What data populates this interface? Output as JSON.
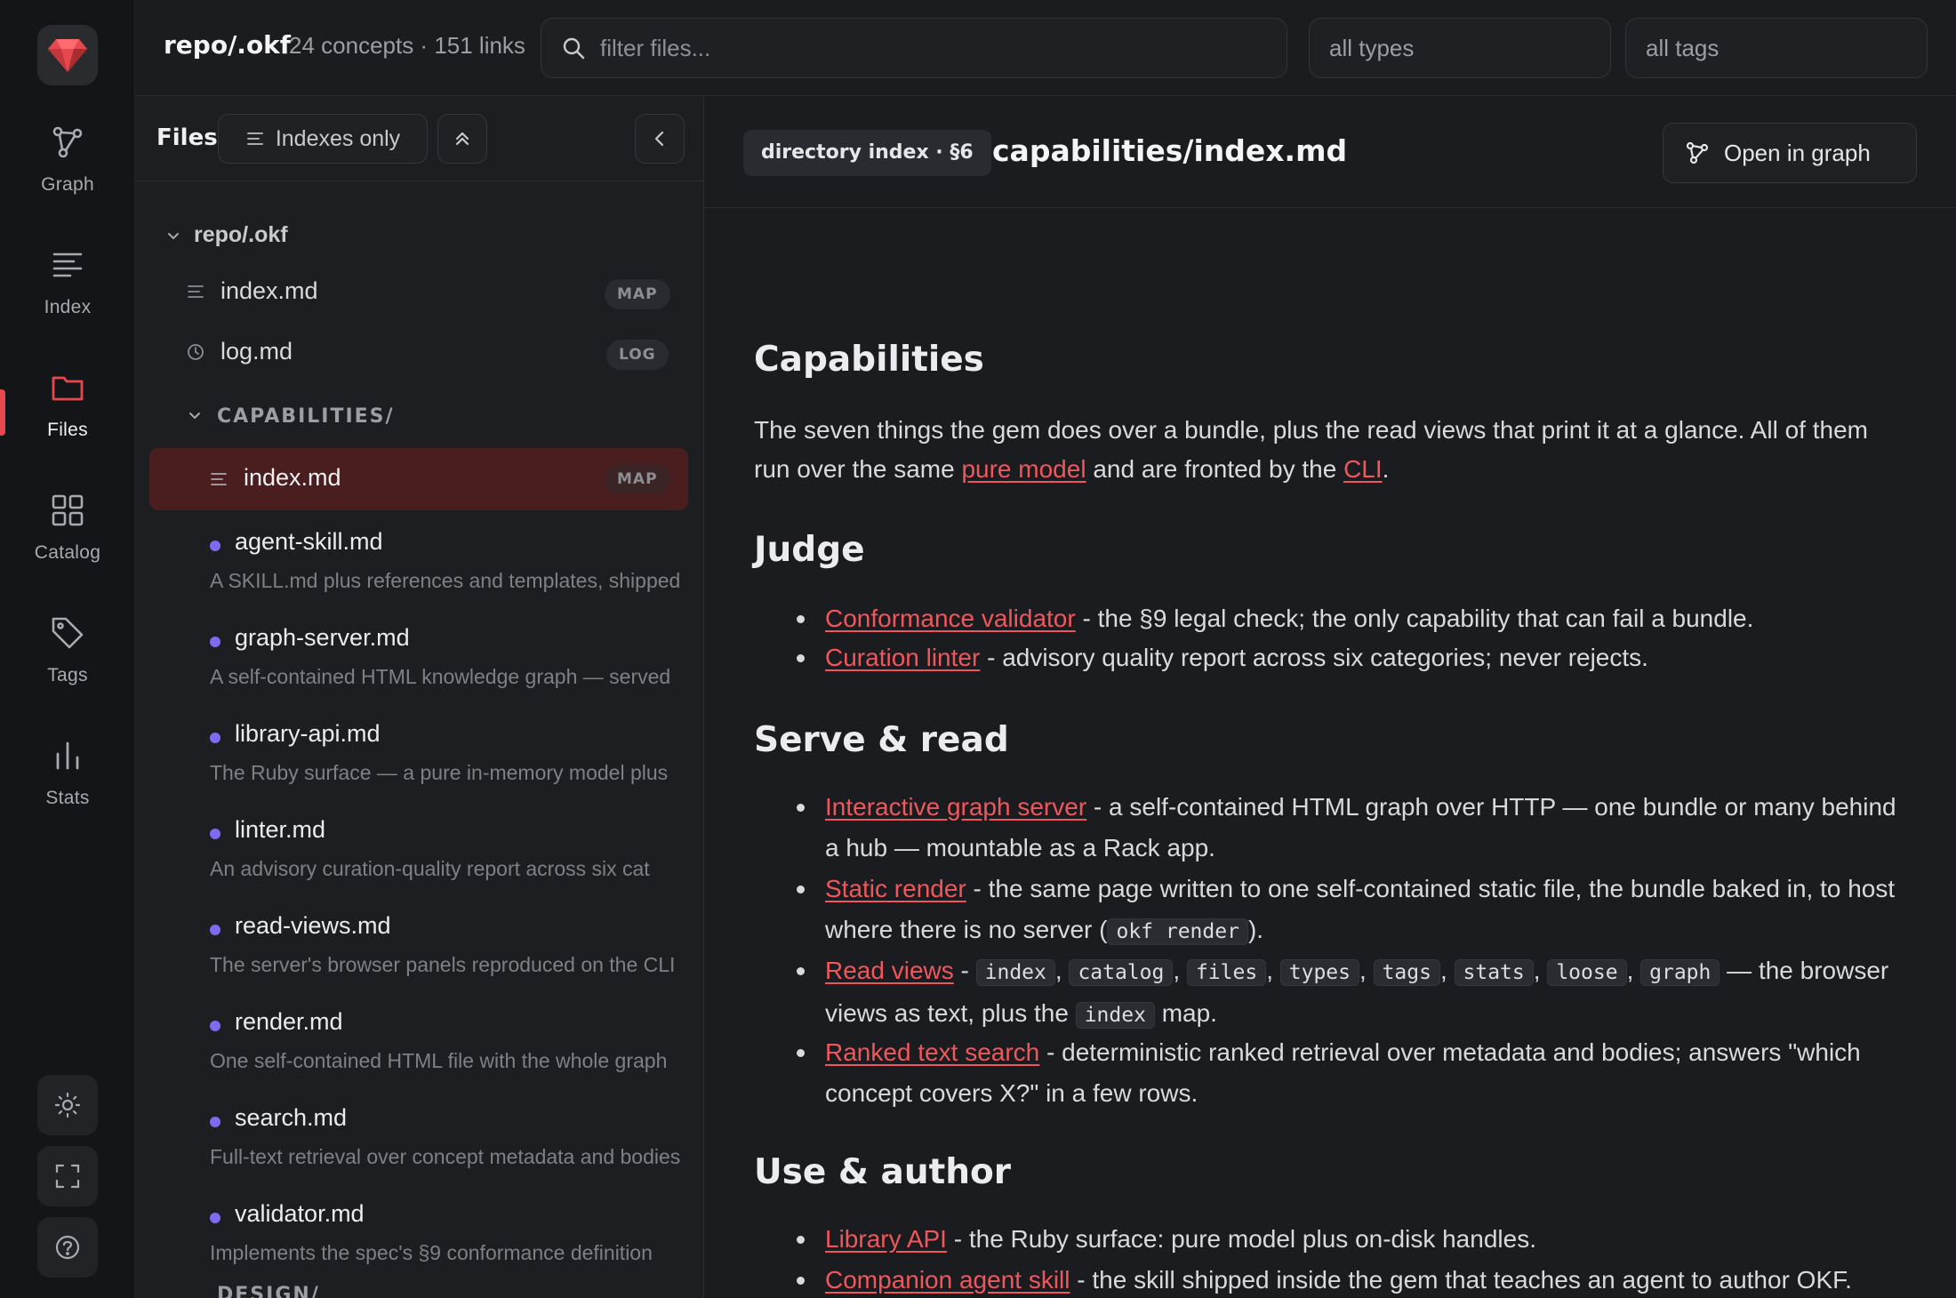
{
  "rail": {
    "items": [
      {
        "label": "Graph"
      },
      {
        "label": "Index"
      },
      {
        "label": "Files"
      },
      {
        "label": "Catalog"
      },
      {
        "label": "Tags"
      },
      {
        "label": "Stats"
      }
    ],
    "active": "Files"
  },
  "topbar": {
    "repo": "repo/.okf",
    "stats": "24 concepts · 151 links",
    "search_placeholder": "filter files...",
    "types_select": "all types",
    "tags_select": "all tags"
  },
  "files": {
    "title": "Files",
    "indexes_only": "Indexes only",
    "root_folder": "repo/.okf",
    "root_items": [
      {
        "name": "index.md",
        "badge": "MAP"
      },
      {
        "name": "log.md",
        "badge": "LOG"
      }
    ],
    "sub_folder": "CAPABILITIES/",
    "selected": {
      "name": "index.md",
      "badge": "MAP"
    },
    "concepts": [
      {
        "name": "agent-skill.md",
        "desc": "A SKILL.md plus references and templates, shipped"
      },
      {
        "name": "graph-server.md",
        "desc": "A self-contained HTML knowledge graph — served"
      },
      {
        "name": "library-api.md",
        "desc": "The Ruby surface — a pure in-memory model plus"
      },
      {
        "name": "linter.md",
        "desc": "An advisory curation-quality report across six cat"
      },
      {
        "name": "read-views.md",
        "desc": "The server's browser panels reproduced on the CLI"
      },
      {
        "name": "render.md",
        "desc": "One self-contained HTML file with the whole graph"
      },
      {
        "name": "search.md",
        "desc": "Full-text retrieval over concept metadata and bodies"
      },
      {
        "name": "validator.md",
        "desc": "Implements the spec's §9 conformance definition"
      }
    ],
    "next_folder": "DESIGN/"
  },
  "content": {
    "chip": "directory index · §6",
    "title": "capabilities/index.md",
    "open_graph": "Open in graph",
    "h_capabilities": "Capabilities",
    "intro_1": "The seven things the gem does over a bundle, plus the read views that print it at a glance. All of them run over the same ",
    "intro_link_1": "pure model",
    "intro_2": " and are fronted by the ",
    "intro_link_2": "CLI",
    "intro_3": ".",
    "h_judge": "Judge",
    "judge": [
      {
        "link": "Conformance validator",
        "text": " - the §9 legal check; the only capability that can fail a bundle."
      },
      {
        "link": "Curation linter",
        "text": " - advisory quality report across six categories; never rejects."
      }
    ],
    "h_serve": "Serve & read",
    "serve_1_link": "Interactive graph server",
    "serve_1_text": " - a self-contained HTML graph over HTTP — one bundle or many behind a hub — mountable as a Rack app.",
    "serve_2_link": "Static render",
    "serve_2_text": " - the same page written to one self-contained static file, the bundle baked in, to host where there is no server (",
    "serve_2_code": "okf render",
    "serve_2_end": ").",
    "serve_3_link": "Read views",
    "serve_3_sep": " - ",
    "serve_3_codes": [
      "index",
      "catalog",
      "files",
      "types",
      "tags",
      "stats",
      "loose",
      "graph"
    ],
    "serve_3_text": " — the browser views as text, plus the ",
    "serve_3_code_end": "index",
    "serve_3_end": " map.",
    "serve_4_link": "Ranked text search",
    "serve_4_text": " - deterministic ranked retrieval over metadata and bodies; answers \"which concept covers X?\" in a few rows.",
    "h_use": "Use & author",
    "use": [
      {
        "link": "Library API",
        "text": " - the Ruby surface: pure model plus on-disk handles."
      },
      {
        "link": "Companion agent skill",
        "text": " - the skill shipped inside the gem that teaches an agent to author OKF."
      }
    ]
  },
  "colors": {
    "accent": "#e5484d",
    "link": "#f0575c",
    "dot": "#7c6cf0",
    "selected": "#4a1d1f"
  }
}
